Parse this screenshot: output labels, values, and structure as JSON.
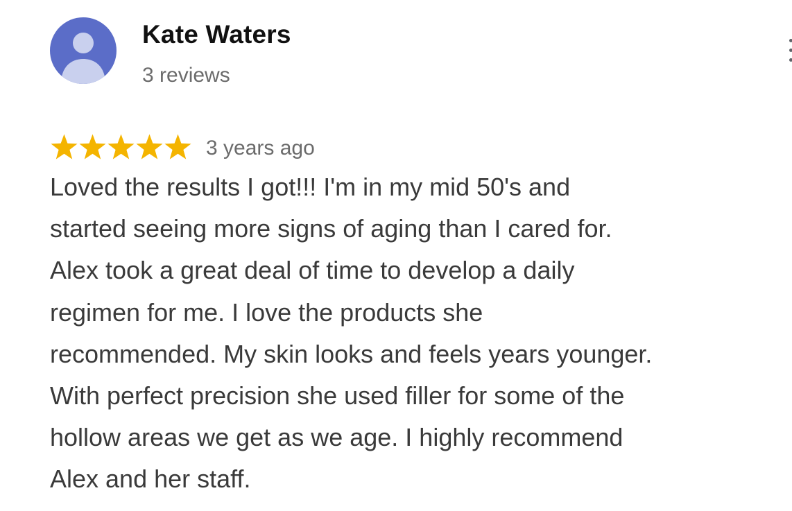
{
  "review": {
    "author": {
      "name": "Kate Waters",
      "review_count": "3 reviews",
      "avatar_icon": "person-icon",
      "avatar_color": "#5b6dc8"
    },
    "rating": 5,
    "rating_max": 5,
    "star_color": "#f4b400",
    "time": "3 years ago",
    "text_lines": [
      "Loved the results I got!!! I'm in my mid 50's and",
      "started seeing more signs of aging than I cared for.",
      "Alex took a great deal of time to develop a daily",
      "regimen for me. I love the products she",
      "recommended. My skin looks and feels years younger.",
      "With perfect precision she used filler for some of the",
      "hollow areas we get as we age. I highly recommend",
      "Alex and her staff."
    ]
  }
}
